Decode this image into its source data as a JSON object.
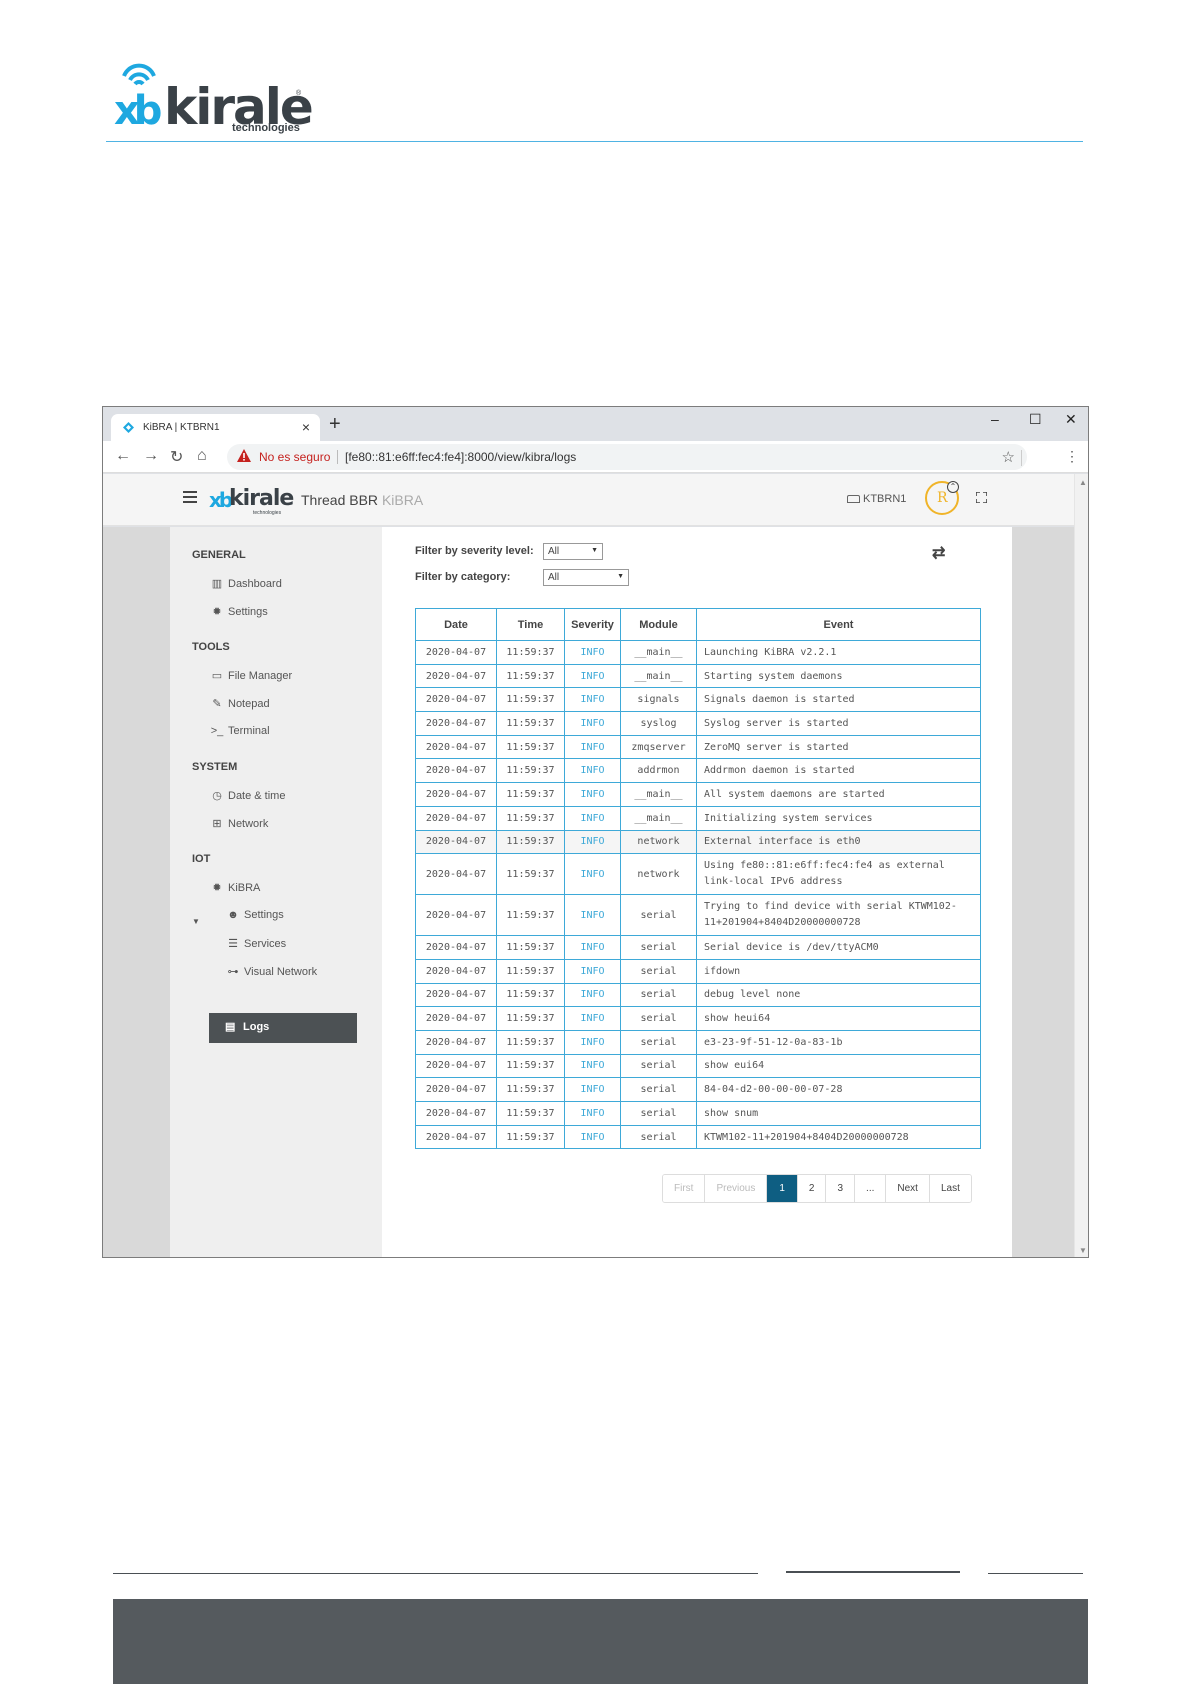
{
  "document": {
    "logo": {
      "brand": "kirale",
      "mark": "xb",
      "tagline": "technologies",
      "registered": "®"
    }
  },
  "browser": {
    "tab_title": "KiBRA | KTBRN1",
    "tab_close": "×",
    "new_tab": "+",
    "window_controls": {
      "minimize": "–",
      "maximize": "☐",
      "close": "✕"
    },
    "nav": {
      "back": "←",
      "forward": "→",
      "reload": "↻",
      "home": "⌂"
    },
    "security_label": "No es seguro",
    "url": "[fe80::81:e6ff:fec4:fe4]:8000/view/kibra/logs",
    "bookmark": "☆",
    "menu": "⋮"
  },
  "app": {
    "logo": {
      "mark": "xb",
      "brand": "kirale",
      "tagline": "technologies"
    },
    "title": "Thread BBR",
    "subtitle": "KiBRA",
    "device_name": "KTBRN1",
    "avatar_letter": "R",
    "avatar_badge": "⌃"
  },
  "sidebar": {
    "sections": {
      "general": "GENERAL",
      "tools": "TOOLS",
      "system": "SYSTEM",
      "iot": "IOT"
    },
    "items": {
      "dashboard": "Dashboard",
      "settings": "Settings",
      "file_manager": "File Manager",
      "notepad": "Notepad",
      "terminal": "Terminal",
      "date_time": "Date & time",
      "network": "Network",
      "kibra": "KiBRA",
      "kibra_settings": "Settings",
      "services": "Services",
      "visual_network": "Visual Network",
      "logs": "Logs"
    },
    "icons": {
      "dashboard": "chart-icon",
      "settings": "gear-icon",
      "file_manager": "folder-icon",
      "notepad": "pencil-icon",
      "terminal": "terminal-icon",
      "date_time": "clock-icon",
      "network": "network-icon",
      "kibra": "gear-icon",
      "kibra_settings": "user-gear-icon",
      "services": "server-icon",
      "visual_network": "graph-icon",
      "logs": "file-icon"
    }
  },
  "filters": {
    "severity_label": "Filter by severity level:",
    "severity_value": "All",
    "category_label": "Filter by category:",
    "category_value": "All"
  },
  "logs": {
    "headers": [
      "Date",
      "Time",
      "Severity",
      "Module",
      "Event"
    ],
    "rows": [
      [
        "2020-04-07",
        "11:59:37",
        "INFO",
        "__main__",
        "Launching KiBRA v2.2.1"
      ],
      [
        "2020-04-07",
        "11:59:37",
        "INFO",
        "__main__",
        "Starting system daemons"
      ],
      [
        "2020-04-07",
        "11:59:37",
        "INFO",
        "signals",
        "Signals daemon is started"
      ],
      [
        "2020-04-07",
        "11:59:37",
        "INFO",
        "syslog",
        "Syslog server is started"
      ],
      [
        "2020-04-07",
        "11:59:37",
        "INFO",
        "zmqserver",
        "ZeroMQ server is started"
      ],
      [
        "2020-04-07",
        "11:59:37",
        "INFO",
        "addrmon",
        "Addrmon daemon is started"
      ],
      [
        "2020-04-07",
        "11:59:37",
        "INFO",
        "__main__",
        "All system daemons are started"
      ],
      [
        "2020-04-07",
        "11:59:37",
        "INFO",
        "__main__",
        "Initializing system services"
      ],
      [
        "2020-04-07",
        "11:59:37",
        "INFO",
        "network",
        "External interface is eth0"
      ],
      [
        "2020-04-07",
        "11:59:37",
        "INFO",
        "network",
        "Using fe80::81:e6ff:fec4:fe4 as external link-local IPv6 address"
      ],
      [
        "2020-04-07",
        "11:59:37",
        "INFO",
        "serial",
        "Trying to find device with serial KTWM102-11+201904+8404D20000000728"
      ],
      [
        "2020-04-07",
        "11:59:37",
        "INFO",
        "serial",
        "Serial device is /dev/ttyACM0"
      ],
      [
        "2020-04-07",
        "11:59:37",
        "INFO",
        "serial",
        "ifdown"
      ],
      [
        "2020-04-07",
        "11:59:37",
        "INFO",
        "serial",
        "debug level none"
      ],
      [
        "2020-04-07",
        "11:59:37",
        "INFO",
        "serial",
        "show heui64"
      ],
      [
        "2020-04-07",
        "11:59:37",
        "INFO",
        "serial",
        "e3-23-9f-51-12-0a-83-1b"
      ],
      [
        "2020-04-07",
        "11:59:37",
        "INFO",
        "serial",
        "show eui64"
      ],
      [
        "2020-04-07",
        "11:59:37",
        "INFO",
        "serial",
        "84-04-d2-00-00-00-07-28"
      ],
      [
        "2020-04-07",
        "11:59:37",
        "INFO",
        "serial",
        "show snum"
      ],
      [
        "2020-04-07",
        "11:59:37",
        "INFO",
        "serial",
        "KTWM102-11+201904+8404D20000000728"
      ]
    ]
  },
  "pagination": [
    "First",
    "Previous",
    "1",
    "2",
    "3",
    "...",
    "Next",
    "Last"
  ],
  "colors": {
    "accent": "#3ea9d8",
    "active_page": "#0e5e82",
    "sidebar_active": "#4c5154",
    "brand_blue": "#1ea8e0",
    "avatar": "#f0b429",
    "footer": "#555a5e"
  }
}
